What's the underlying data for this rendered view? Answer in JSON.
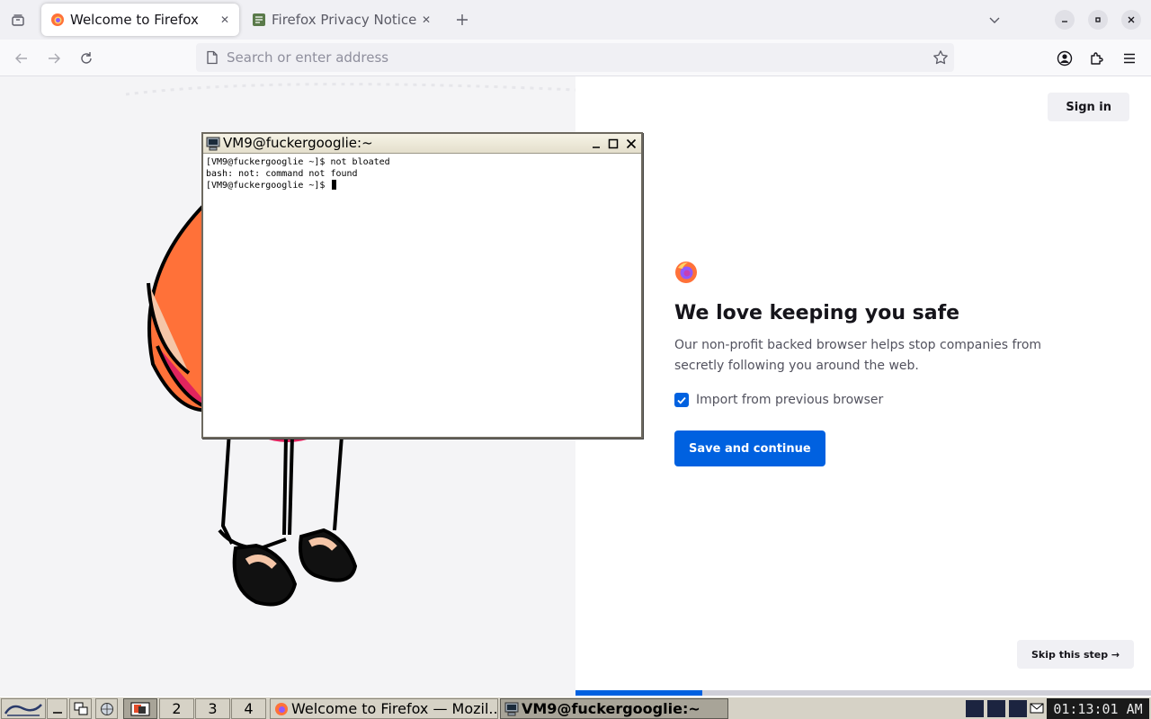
{
  "browser": {
    "tabs": [
      {
        "title": "Welcome to Firefox",
        "selected": true
      },
      {
        "title": "Firefox Privacy Notice —",
        "selected": false
      }
    ],
    "urlbar_placeholder": "Search or enter address"
  },
  "page": {
    "sign_in_label": "Sign in",
    "heading": "We love keeping you safe",
    "body": "Our non-profit backed browser helps stop companies from secretly following you around the web.",
    "import_label": "Import from previous browser",
    "import_checked": true,
    "primary_button": "Save and continue",
    "skip_label": "Skip this step →",
    "progress_fraction": 0.22,
    "colors": {
      "accent": "#0061e0",
      "firefox_orange": "#ff7139",
      "firefox_purple": "#9059ff"
    }
  },
  "terminal": {
    "title": "VM9@fuckergooglie:~",
    "lines": [
      "[VM9@fuckergooglie ~]$ not bloated",
      "bash: not: command not found",
      "[VM9@fuckergooglie ~]$ "
    ]
  },
  "panel": {
    "workspaces": [
      "2",
      "3",
      "4"
    ],
    "tasks": [
      {
        "label": "Welcome to Firefox — Mozil...",
        "icon": "firefox-icon",
        "active": false
      },
      {
        "label": "VM9@fuckergooglie:~",
        "icon": "terminal-icon",
        "active": true
      }
    ],
    "clock": "01:13:01 AM"
  }
}
